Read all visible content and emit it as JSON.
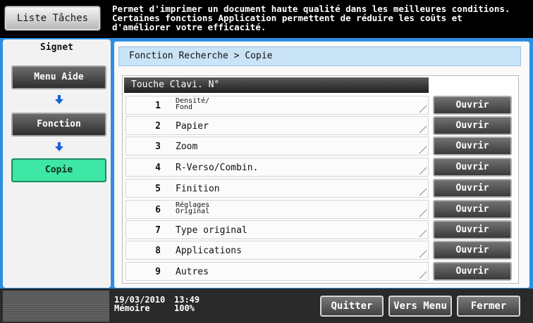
{
  "header": {
    "task_list_label": "Liste Tâches",
    "message": "Permet d'imprimer un document haute qualité dans les meilleures conditions.\nCertaines fonctions Application permettent de réduire les coûts et\nd'améliorer votre efficacité."
  },
  "sidebar": {
    "title": "Signet",
    "items": [
      {
        "label": "Menu Aide",
        "active": false
      },
      {
        "label": "Fonction",
        "active": false
      },
      {
        "label": "Copie",
        "active": true
      }
    ],
    "arrow_icon": "arrow-down-icon",
    "arrow_color": "#1a62d6"
  },
  "main": {
    "breadcrumb": "Fonction Recherche > Copie",
    "list_header": "Touche Clavi. N°",
    "open_label": "Ouvrir",
    "rows": [
      {
        "num": "1",
        "label": "Densité/\nFond",
        "small": true
      },
      {
        "num": "2",
        "label": "Papier",
        "small": false
      },
      {
        "num": "3",
        "label": "Zoom",
        "small": false
      },
      {
        "num": "4",
        "label": "R-Verso/Combin.",
        "small": false
      },
      {
        "num": "5",
        "label": "Finition",
        "small": false
      },
      {
        "num": "6",
        "label": "Réglages\nOriginal",
        "small": true
      },
      {
        "num": "7",
        "label": "Type original",
        "small": false
      },
      {
        "num": "8",
        "label": "Applications",
        "small": false
      },
      {
        "num": "9",
        "label": "Autres",
        "small": false
      }
    ]
  },
  "footer": {
    "date": "19/03/2010",
    "time": "13:49",
    "memory_label": "Mémoire",
    "memory_value": "100%",
    "quit_label": "Quitter",
    "main_menu_label": "Vers Menu",
    "close_label": "Fermer"
  },
  "colors": {
    "frame_blue": "#2d8ee3",
    "active_green": "#3ee7a5",
    "breadcrumb_bg": "#c9e3f7"
  }
}
